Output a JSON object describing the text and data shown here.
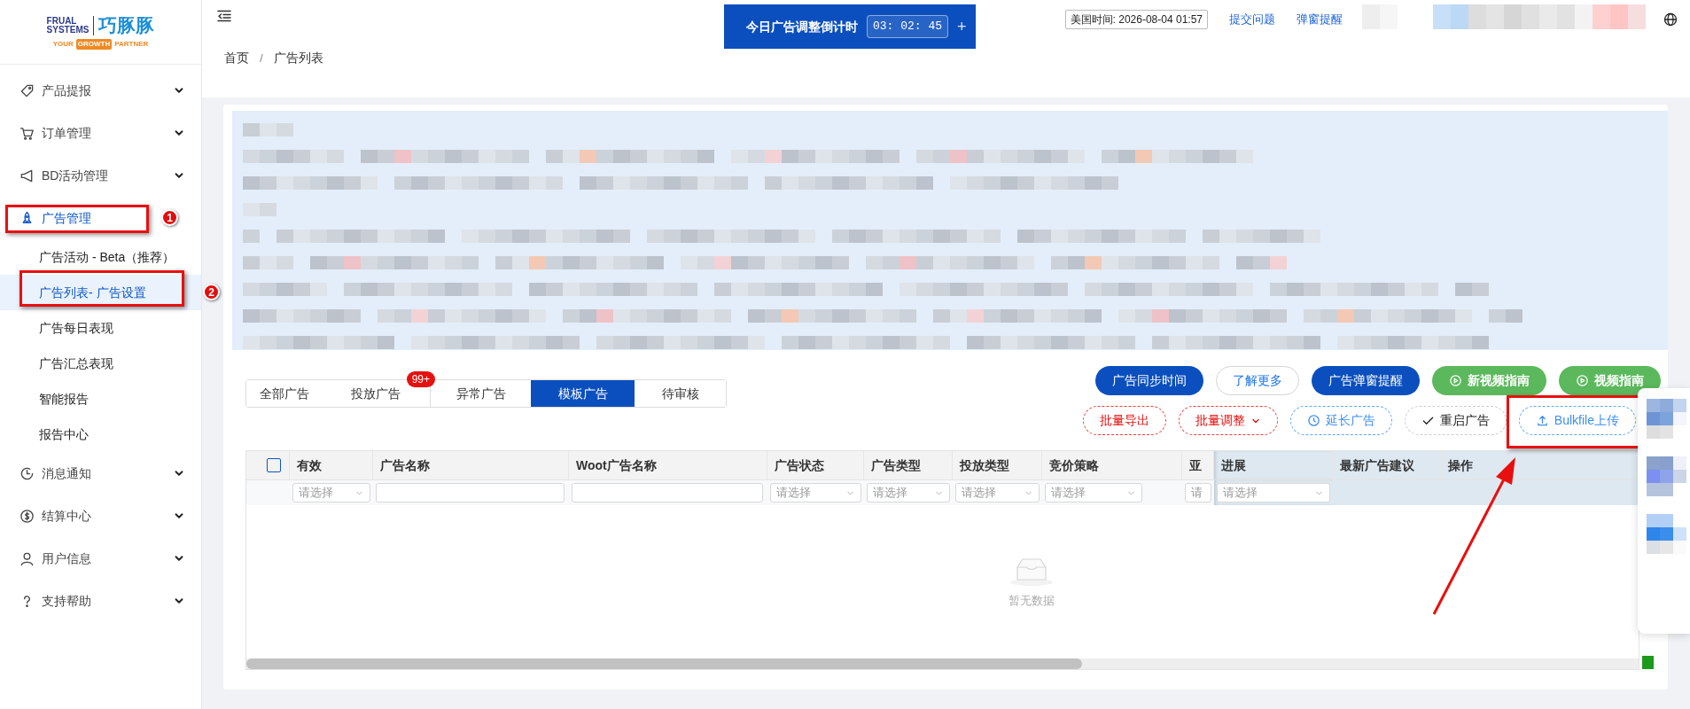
{
  "logo": {
    "name_top": "FRUAL",
    "name_bottom": "SYSTEMS",
    "name_cn": "巧豚豚",
    "tagline_start": "YOUR",
    "tagline_highlight": "GROWTH",
    "tagline_end": "PARTNER"
  },
  "header": {
    "countdown": {
      "label": "今日广告调整倒计时",
      "time": "03: 02: 45",
      "add": "+"
    },
    "us_time": "美国时间: 2026-08-04 01:57",
    "links": [
      "提交问题",
      "弹窗提醒"
    ]
  },
  "sidebar": {
    "items": [
      {
        "label": "产品提报",
        "selected": false,
        "expanded": false
      },
      {
        "label": "订单管理",
        "selected": false,
        "expanded": false
      },
      {
        "label": "BD活动管理",
        "selected": false,
        "expanded": false
      },
      {
        "label": "广告管理",
        "selected": true,
        "expanded": true,
        "highlighted": true,
        "marker": "1",
        "children": [
          {
            "label": "广告活动 - Beta（推荐）",
            "selected": false
          },
          {
            "label": "广告列表- 广告设置",
            "selected": true,
            "highlighted": true,
            "marker": "2"
          },
          {
            "label": "广告每日表现",
            "selected": false
          },
          {
            "label": "广告汇总表现",
            "selected": false
          },
          {
            "label": "智能报告",
            "selected": false
          },
          {
            "label": "报告中心",
            "selected": false
          }
        ]
      },
      {
        "label": "消息通知",
        "selected": false,
        "expanded": false
      },
      {
        "label": "结算中心",
        "selected": false,
        "expanded": false
      },
      {
        "label": "用户信息",
        "selected": false,
        "expanded": false
      },
      {
        "label": "支持帮助",
        "selected": false,
        "expanded": false
      }
    ]
  },
  "breadcrumb": {
    "items": [
      "首页",
      "广告列表"
    ],
    "separator": "/"
  },
  "tabs": [
    {
      "label": "全部广告",
      "selected": false
    },
    {
      "label": "投放广告",
      "selected": false,
      "badge": "99+"
    },
    {
      "label": "异常广告",
      "selected": false
    },
    {
      "label": "模板广告",
      "selected": true
    },
    {
      "label": "待审核",
      "selected": false
    }
  ],
  "toolbar": {
    "primary_buttons": [
      {
        "label": "广告同步时间",
        "kind": "primary"
      },
      {
        "label": "了解更多",
        "kind": "outline"
      },
      {
        "label": "广告弹窗提醒",
        "kind": "primary"
      },
      {
        "label": "新视频指南",
        "kind": "success"
      },
      {
        "label": "视频指南",
        "kind": "success"
      }
    ],
    "batch_buttons": [
      {
        "label": "批量导出",
        "kind": "danger",
        "dropdown": false
      },
      {
        "label": "批量调整",
        "kind": "danger",
        "dropdown": true
      },
      {
        "label": "延长广告",
        "kind": "info",
        "dropdown": false
      },
      {
        "label": "重启广告",
        "kind": "default",
        "dropdown": false
      },
      {
        "label": "Bulkfile上传",
        "kind": "info",
        "dropdown": false,
        "highlighted": true
      }
    ]
  },
  "table": {
    "header_checkbox": {
      "checked": false
    },
    "columns": [
      {
        "label": "有效",
        "filter": {
          "kind": "select",
          "placeholder": "请选择"
        },
        "fixed": false
      },
      {
        "label": "广告名称",
        "filter": {
          "kind": "text"
        },
        "fixed": false
      },
      {
        "label": "Woot广告名称",
        "filter": {
          "kind": "text"
        },
        "fixed": false
      },
      {
        "label": "广告状态",
        "filter": {
          "kind": "select",
          "placeholder": "请选择"
        },
        "fixed": false
      },
      {
        "label": "广告类型",
        "filter": {
          "kind": "select",
          "placeholder": "请选择"
        },
        "fixed": false
      },
      {
        "label": "投放类型",
        "filter": {
          "kind": "select",
          "placeholder": "请选择"
        },
        "fixed": false
      },
      {
        "label": "竞价策略",
        "filter": {
          "kind": "select",
          "placeholder": "请选择"
        },
        "fixed": false
      },
      {
        "label": "亚",
        "filter": {
          "kind": "select",
          "placeholder": "请"
        },
        "fixed": false
      },
      {
        "label": "进展",
        "filter": {
          "kind": "select",
          "placeholder": "请选择"
        },
        "fixed": true
      },
      {
        "label": "最新广告建议",
        "fixed": true
      },
      {
        "label": "操作",
        "fixed": true
      }
    ],
    "empty_text": "暂无数据"
  }
}
